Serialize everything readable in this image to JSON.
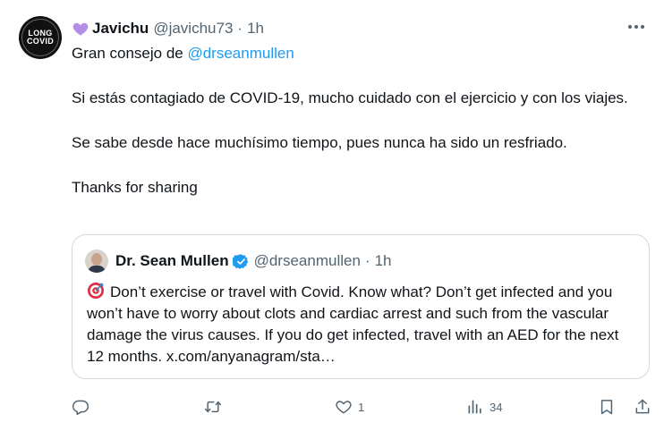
{
  "author": {
    "avatar_text": [
      "LONG",
      "COVID"
    ],
    "name": "Javichu",
    "handle": "@javichu73",
    "separator": "·",
    "time": "1h"
  },
  "tweet": {
    "intro": "Gran consejo de ",
    "mention": "@drseanmullen",
    "paragraphs": [
      "Si estás contagiado de COVID-19, mucho cuidado con el ejercicio y con los viajes.",
      "Se sabe desde hace muchísimo tiempo, pues nunca ha sido un resfriado.",
      "Thanks for sharing"
    ]
  },
  "quote": {
    "name": "Dr. Sean Mullen",
    "handle": "@drseanmullen",
    "separator": "·",
    "time": "1h",
    "text": "Don’t exercise or travel with Covid. Know what? Don’t get infected and you won’t have to worry about clots and cardiac arrest and such from the vascular damage the virus causes. If you do get infected, travel with an AED for the next 12 months. x.com/anyanagram/sta…"
  },
  "actions": {
    "reply_count": "",
    "repost_count": "",
    "like_count": "1",
    "views_count": "34"
  },
  "colors": {
    "accent": "#1d9bf0",
    "secondary_text": "#536471",
    "border": "#cfd9de",
    "heart": "#b48ee6"
  },
  "icons": [
    "purple-heart-icon",
    "more-icon",
    "verified-badge-icon",
    "target-icon",
    "reply-icon",
    "repost-icon",
    "like-icon",
    "views-icon",
    "bookmark-icon",
    "share-icon"
  ]
}
